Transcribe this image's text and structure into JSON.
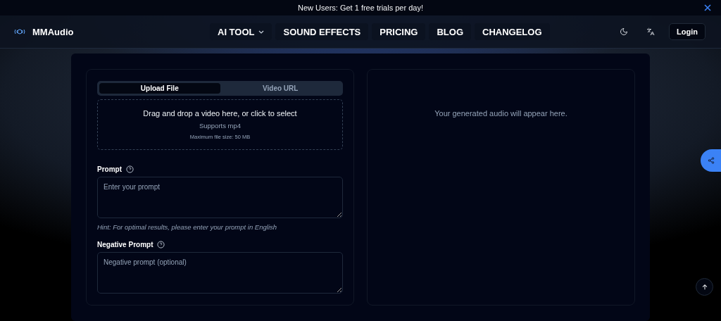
{
  "banner": {
    "text": "New Users: Get 1 free trials per day!"
  },
  "header": {
    "brand": "MMAudio",
    "nav": [
      {
        "label": "AI TOOL",
        "dropdown": true
      },
      {
        "label": "SOUND EFFECTS",
        "dropdown": false
      },
      {
        "label": "PRICING",
        "dropdown": false
      },
      {
        "label": "BLOG",
        "dropdown": false
      },
      {
        "label": "CHANGELOG",
        "dropdown": false
      }
    ],
    "login": "Login"
  },
  "upload": {
    "tabs": [
      {
        "label": "Upload File",
        "selected": true
      },
      {
        "label": "Video URL",
        "selected": false
      }
    ],
    "dropzone": {
      "title": "Drag and drop a video here, or click to select",
      "formats": "Supports mp4",
      "limit": "Maximum file size: 50 MB"
    }
  },
  "prompt": {
    "label": "Prompt",
    "placeholder": "Enter your prompt",
    "hint": "Hint: For optimal results, please enter your prompt in English"
  },
  "negative_prompt": {
    "label": "Negative Prompt",
    "placeholder": "Negative prompt (optional)"
  },
  "output": {
    "empty_text": "Your generated audio will appear here."
  }
}
